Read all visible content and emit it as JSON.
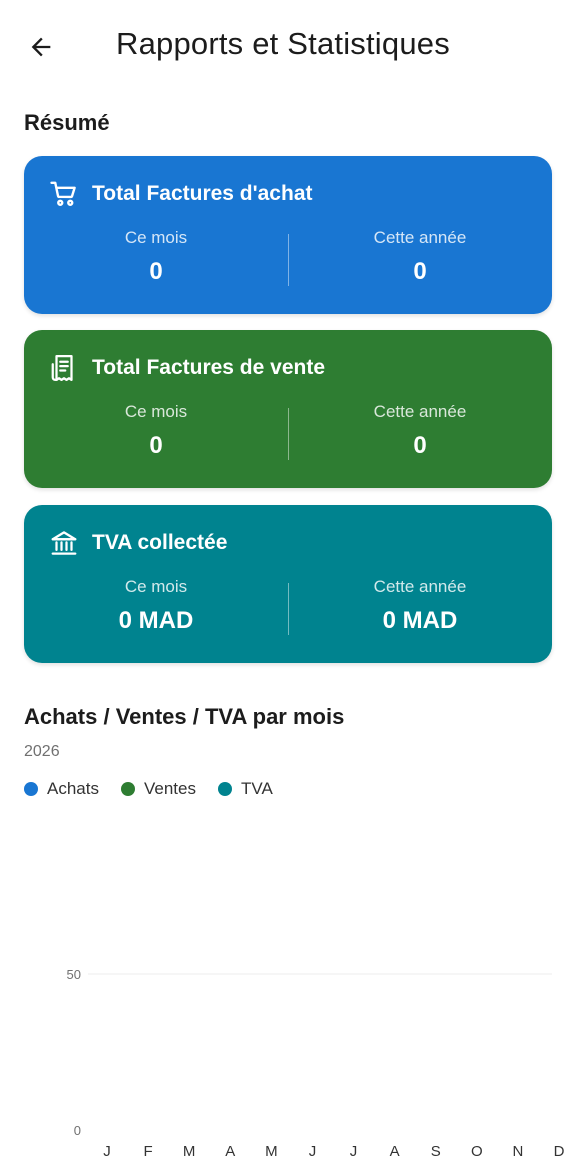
{
  "appbar": {
    "title": "Rapports et Statistiques",
    "back_icon": "arrow-left-icon"
  },
  "summary": {
    "title": "Résumé",
    "cards": [
      {
        "title": "Total Factures d'achat",
        "icon": "shopping-cart-icon",
        "color": "#1976d2",
        "month_label": "Ce mois",
        "month_value": "0",
        "year_label": "Cette année",
        "year_value": "0"
      },
      {
        "title": "Total Factures de vente",
        "icon": "receipt-icon",
        "color": "#2e7d32",
        "month_label": "Ce mois",
        "month_value": "0",
        "year_label": "Cette année",
        "year_value": "0"
      },
      {
        "title": "TVA collectée",
        "icon": "bank-icon",
        "color": "#00838f",
        "month_label": "Ce mois",
        "month_value": "0 MAD",
        "year_label": "Cette année",
        "year_value": "0 MAD"
      }
    ]
  },
  "chart_section": {
    "title": "Achats / Ventes / TVA par mois",
    "year": "2026",
    "legend": [
      {
        "label": "Achats",
        "color": "#1976d2"
      },
      {
        "label": "Ventes",
        "color": "#2e7d32"
      },
      {
        "label": "TVA",
        "color": "#00838f"
      }
    ]
  },
  "chart_data": {
    "type": "bar",
    "categories": [
      "J",
      "F",
      "M",
      "A",
      "M",
      "J",
      "J",
      "A",
      "S",
      "O",
      "N",
      "D"
    ],
    "series": [
      {
        "name": "Achats",
        "values": [
          0,
          0,
          0,
          0,
          0,
          0,
          0,
          0,
          0,
          0,
          0,
          0
        ],
        "color": "#1976d2"
      },
      {
        "name": "Ventes",
        "values": [
          0,
          0,
          0,
          0,
          0,
          0,
          0,
          0,
          0,
          0,
          0,
          0
        ],
        "color": "#2e7d32"
      },
      {
        "name": "TVA",
        "values": [
          0,
          0,
          0,
          0,
          0,
          0,
          0,
          0,
          0,
          0,
          0,
          0
        ],
        "color": "#00838f"
      }
    ],
    "ylim": [
      0,
      50
    ],
    "yticks": [
      "0",
      "50"
    ],
    "grid": true,
    "legend": "top-left"
  }
}
